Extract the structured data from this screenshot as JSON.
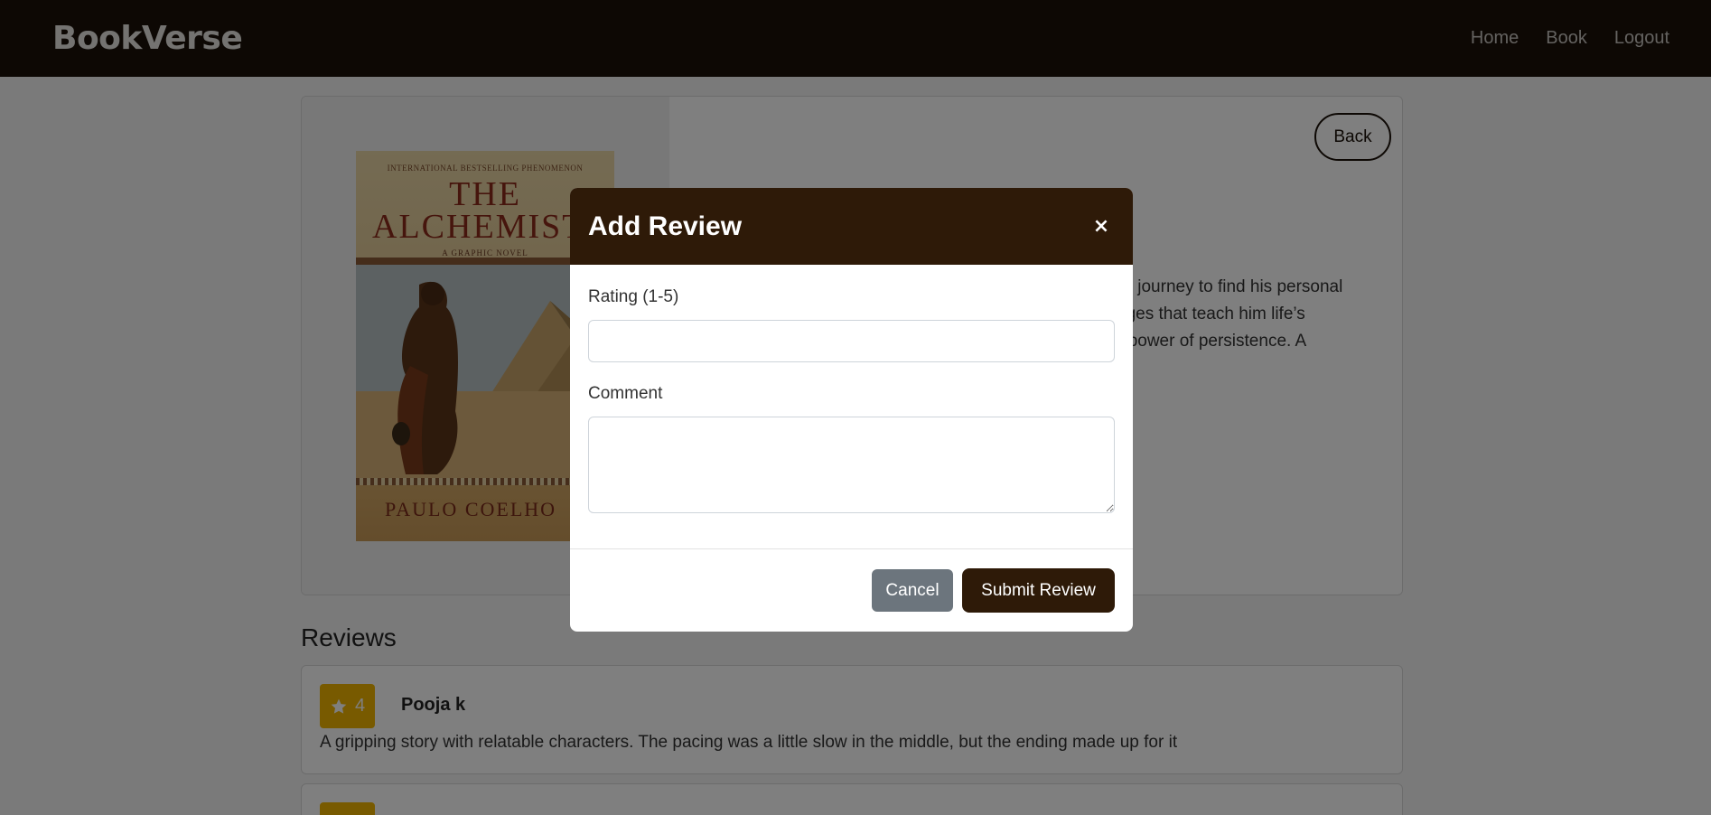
{
  "navbar": {
    "brand": "BookVerse",
    "links": [
      "Home",
      "Book",
      "Logout"
    ]
  },
  "book": {
    "cover": {
      "top_line": "INTERNATIONAL BESTSELLING PHENOMENON",
      "title_line1": "THE",
      "title_line2": "ALCHEMIST",
      "subtitle": "A GRAPHIC NOVEL",
      "author": "PAULO COELHO"
    },
    "back_label": "Back",
    "description_line1": "on a journey to find his personal",
    "description_line2": "llenges that teach him life’s",
    "description_line3": "the power of persistence. A"
  },
  "reviews": {
    "heading": "Reviews",
    "items": [
      {
        "rating": "4",
        "name": "Pooja k",
        "comment": "A gripping story with relatable characters. The pacing was a little slow in the middle, but the ending made up for it"
      }
    ]
  },
  "modal": {
    "title": "Add Review",
    "close_icon": "×",
    "rating_label": "Rating (1-5)",
    "rating_value": "",
    "comment_label": "Comment",
    "comment_value": "",
    "cancel_label": "Cancel",
    "submit_label": "Submit Review"
  },
  "colors": {
    "navbar_bg": "#1a1108",
    "modal_header_bg": "#2e1a08",
    "submit_bg": "#2e1a08",
    "cancel_bg": "#6c757d",
    "rating_badge_bg": "#f0b400"
  },
  "icons": {
    "close": "close-icon",
    "star": "star-icon"
  }
}
